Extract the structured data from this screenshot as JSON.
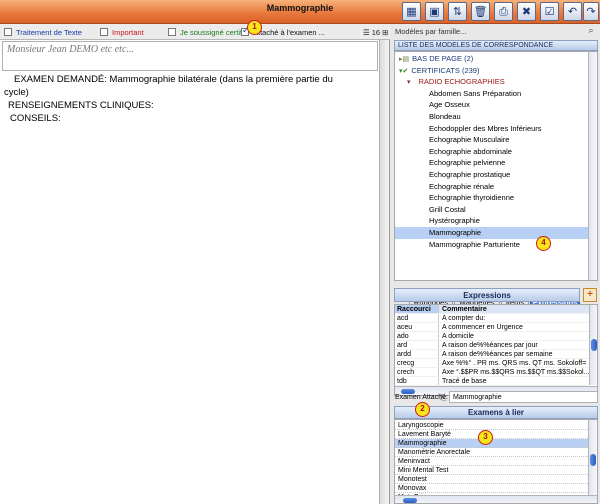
{
  "window": {
    "title": "Mammographie"
  },
  "toolbar_icons": [
    "grid-icon",
    "disk-icon",
    "filing-icon",
    "trash-icon",
    "print-icon",
    "close-window-icon",
    "checkbox-edit-icon",
    "undo-icon",
    "redo-icon"
  ],
  "options": {
    "traitement": "Traitement de Texte",
    "important": "Important",
    "soussigne": "Je soussigné certifi",
    "attache": "Attaché à l'examen ...",
    "font_size": "16"
  },
  "markers": [
    "1",
    "2",
    "3",
    "4"
  ],
  "editor": {
    "patient": "Monsieur Jean DEMO etc etc...",
    "line1": "EXAMEN DEMANDÉ: Mammographie bilatérale   (dans la première partie du",
    "line1b": "cycle)",
    "line2": "RENSEIGNEMENTS CLINIQUES:",
    "line3": "CONSEILS:"
  },
  "right": {
    "family_placeholder": "Modèles par famille...",
    "list_title": "LISTE DES MODELES DE CORRESPONDANCE",
    "tree": [
      {
        "label": "BAS DE PAGE (2)",
        "level": 0,
        "kind": "folder-closed"
      },
      {
        "label": "CERTIFICATS (239)",
        "level": 0,
        "kind": "folder-open"
      },
      {
        "label": "RADIO  ECHOGRAPHIES",
        "level": 1,
        "kind": "category"
      },
      {
        "label": "Abdomen Sans Préparation",
        "level": 2,
        "kind": "item"
      },
      {
        "label": "Age Osseux",
        "level": 2,
        "kind": "item"
      },
      {
        "label": "Blondeau",
        "level": 2,
        "kind": "item"
      },
      {
        "label": "Echodoppler des Mbres Inférieurs",
        "level": 2,
        "kind": "item"
      },
      {
        "label": "Echographie Musculaire",
        "level": 2,
        "kind": "item"
      },
      {
        "label": "Echographie abdominale",
        "level": 2,
        "kind": "item"
      },
      {
        "label": "Echographie pelvienne",
        "level": 2,
        "kind": "item"
      },
      {
        "label": "Echographie prostatique",
        "level": 2,
        "kind": "item"
      },
      {
        "label": "Echographie rénale",
        "level": 2,
        "kind": "item"
      },
      {
        "label": "Echographie thyroidienne",
        "level": 2,
        "kind": "item"
      },
      {
        "label": "Grill Costal",
        "level": 2,
        "kind": "item"
      },
      {
        "label": "Hystérographie",
        "level": 2,
        "kind": "item"
      },
      {
        "label": "Mammographie",
        "level": 2,
        "kind": "item",
        "selected": true
      },
      {
        "label": "Mammographie Parturiente",
        "level": 2,
        "kind": "item"
      }
    ],
    "tabs": [
      "Rubriques",
      "Maquettes",
      "Items",
      "Expressions"
    ],
    "active_tab": "Expressions",
    "expressions_title": "Expressions",
    "expr_headers": {
      "key": "Raccourci",
      "val": "Commentaire"
    },
    "expressions": [
      {
        "k": "acd",
        "v": "A compter du:"
      },
      {
        "k": "aceu",
        "v": "A commencer en Urgence"
      },
      {
        "k": "ado",
        "v": "A domicile"
      },
      {
        "k": "ard",
        "v": "A raison de%%éances par jour"
      },
      {
        "k": "ardd",
        "v": "A raison de%%éances par semaine"
      },
      {
        "k": "crecg",
        "v": "Axe %%° . PR ms. QRS ms. QT ms. Sokoloff= ..."
      },
      {
        "k": "crech",
        "v": "Axe  °.$$PR ms.$$QRS ms.$$QT ms.$$Sokol..."
      },
      {
        "k": "tdb",
        "v": "Tracé de base"
      }
    ],
    "exam_attache_label": "Examen Attaché:",
    "exam_attache_value": "Mammographie",
    "examens_title": "Examens à lier",
    "examens": [
      {
        "label": "Laryngoscopie"
      },
      {
        "label": "Lavement Baryté"
      },
      {
        "label": "Mammographie",
        "selected": true
      },
      {
        "label": "Manométrie Anorectale"
      },
      {
        "label": "Meninvact"
      },
      {
        "label": "Mini Mental Test"
      },
      {
        "label": "Monotest"
      },
      {
        "label": "Monovax"
      },
      {
        "label": "MutaGrip"
      }
    ]
  }
}
